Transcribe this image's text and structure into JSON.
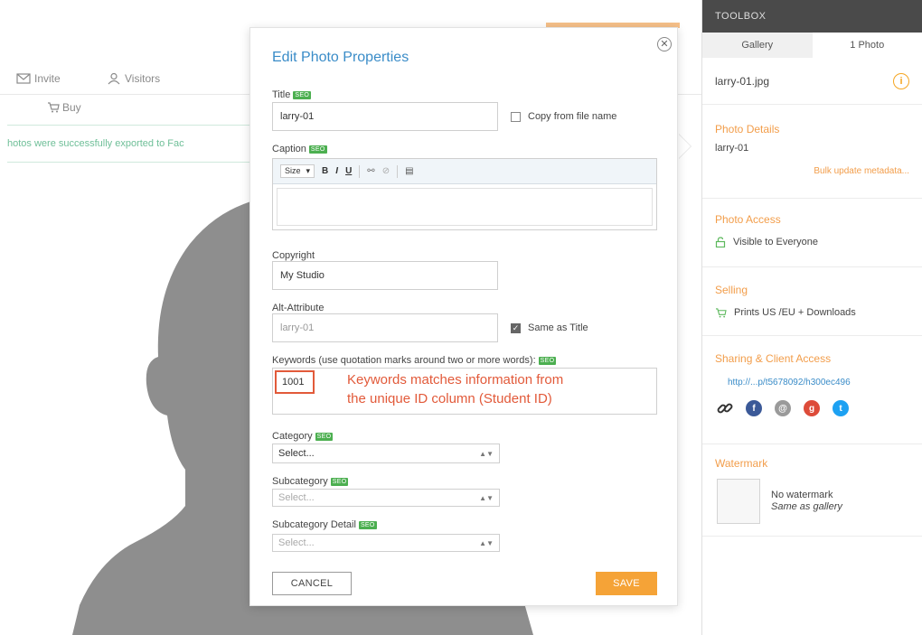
{
  "background": {
    "invite_label": "Invite",
    "visitors_label": "Visitors",
    "buy_label": "Buy",
    "success_message": "hotos were successfully exported to Fac"
  },
  "toolbox": {
    "header": "TOOLBOX",
    "tabs": [
      {
        "label": "Gallery"
      },
      {
        "label": "1 Photo"
      }
    ],
    "filename": "larry-01.jpg",
    "photo_details": {
      "title": "Photo Details",
      "value": "larry-01",
      "bulk_link": "Bulk update metadata..."
    },
    "photo_access": {
      "title": "Photo Access",
      "value": "Visible to Everyone"
    },
    "selling": {
      "title": "Selling",
      "value": "Prints US /EU + Downloads"
    },
    "sharing": {
      "title": "Sharing & Client Access",
      "url": "http://...p/t5678092/h300ec496"
    },
    "watermark": {
      "title": "Watermark",
      "line1": "No watermark",
      "line2": "Same as gallery"
    }
  },
  "modal": {
    "title": "Edit Photo Properties",
    "seo_badge": "SEO",
    "title_label": "Title",
    "title_value": "larry-01",
    "copy_filename_label": "Copy from file name",
    "caption_label": "Caption",
    "editor_font_size": "Size",
    "copyright_label": "Copyright",
    "copyright_value": "My Studio",
    "alt_label": "Alt-Attribute",
    "alt_value": "larry-01",
    "same_as_title_label": "Same as Title",
    "keywords_label": "Keywords (use quotation marks around two or more words):",
    "keyword_value": "1001",
    "keyword_note_line1": "Keywords matches information from",
    "keyword_note_line2": "the unique ID column (Student ID)",
    "category_label": "Category",
    "category_value": "Select...",
    "subcategory_label": "Subcategory",
    "subcategory_value": "Select...",
    "subcategory_detail_label": "Subcategory Detail",
    "subcategory_detail_value": "Select...",
    "cancel_label": "CANCEL",
    "save_label": "SAVE"
  },
  "colors": {
    "accent_blue": "#3a8cc8",
    "accent_orange": "#f5a337",
    "annotation_red": "#e25a3a",
    "seo_green": "#4caf50"
  }
}
